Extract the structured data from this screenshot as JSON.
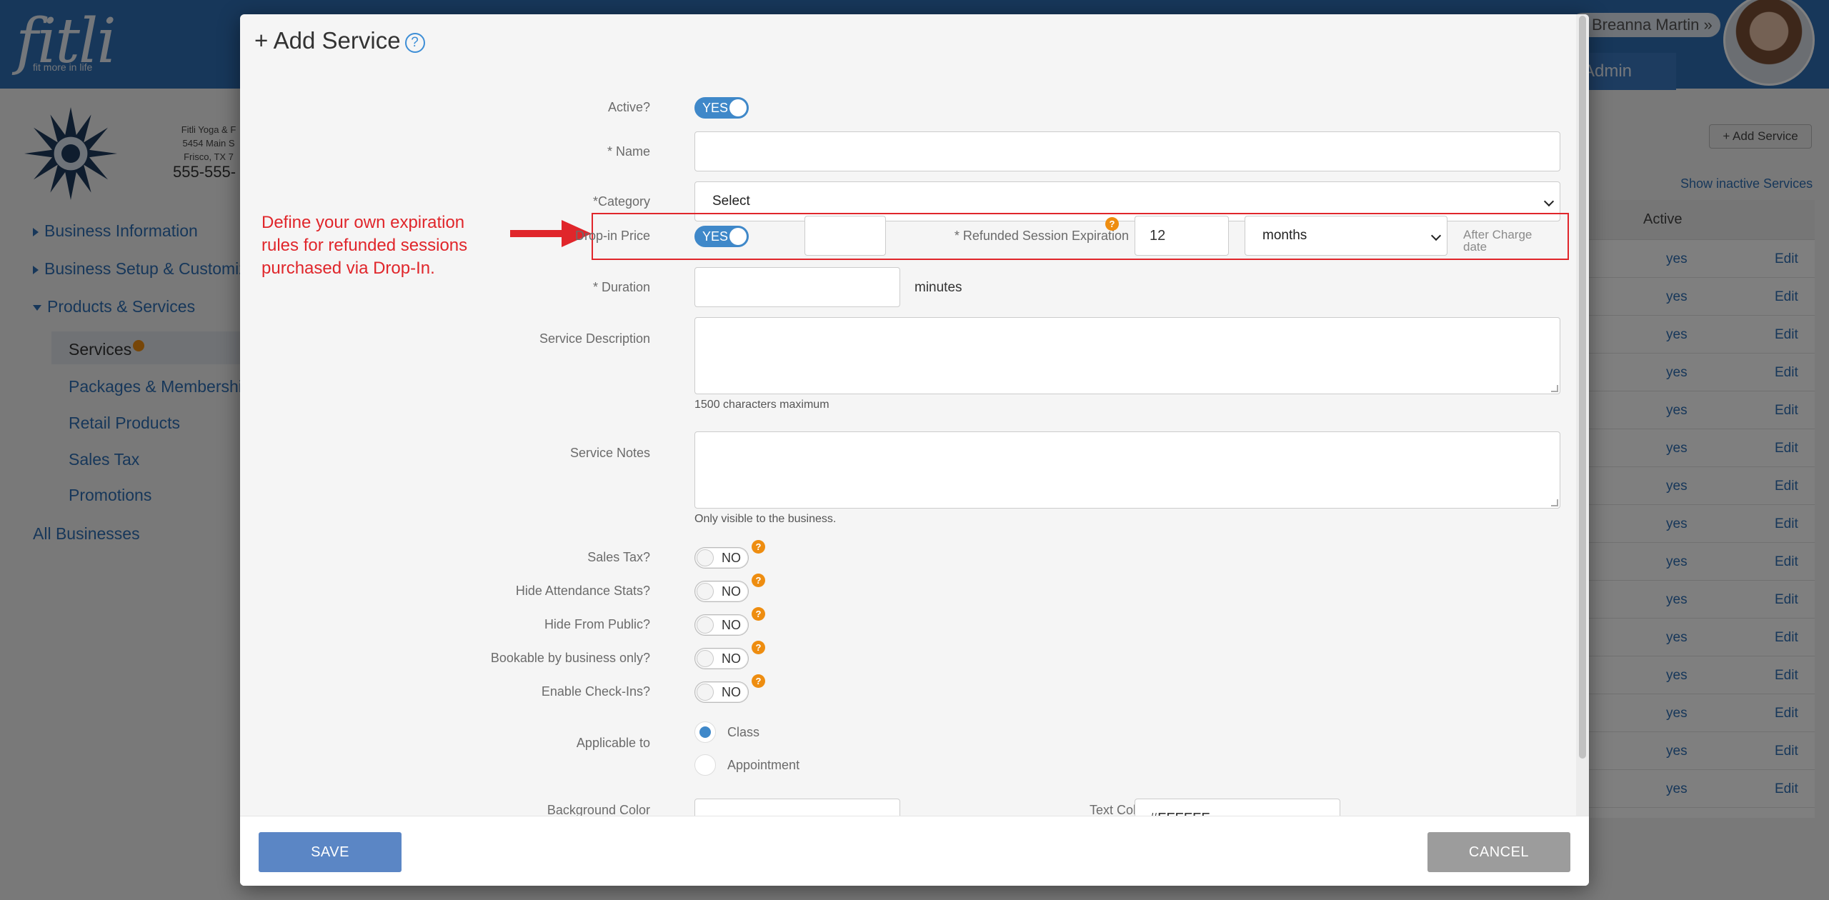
{
  "background": {
    "logo": "fitli",
    "tagline": "fit more in life",
    "user_name": "Breanna Martin",
    "admin_label": "Admin",
    "business_info": [
      "Fitli Yoga & F",
      "5454 Main S",
      "Frisco, TX 7"
    ],
    "phone": "555-555-",
    "nav": {
      "business_information": "Business Information",
      "business_setup": "Business Setup & Customizati",
      "products_services": "Products & Services",
      "services": "Services",
      "packages": "Packages & Memberships",
      "retail": "Retail Products",
      "sales_tax": "Sales Tax",
      "promotions": "Promotions",
      "all_businesses": "All Businesses"
    },
    "add_service_button": "+ Add Service",
    "show_inactive": "Show inactive Services",
    "table_header_active": "Active",
    "rows": [
      {
        "active": "yes",
        "edit": "Edit"
      },
      {
        "active": "yes",
        "edit": "Edit"
      },
      {
        "active": "yes",
        "edit": "Edit"
      },
      {
        "active": "yes",
        "edit": "Edit"
      },
      {
        "active": "yes",
        "edit": "Edit"
      },
      {
        "active": "yes",
        "edit": "Edit"
      },
      {
        "active": "yes",
        "edit": "Edit"
      },
      {
        "active": "yes",
        "edit": "Edit"
      },
      {
        "active": "yes",
        "edit": "Edit"
      },
      {
        "active": "yes",
        "edit": "Edit"
      },
      {
        "active": "yes",
        "edit": "Edit"
      },
      {
        "active": "yes",
        "edit": "Edit"
      },
      {
        "active": "yes",
        "edit": "Edit"
      },
      {
        "active": "yes",
        "edit": "Edit"
      },
      {
        "active": "yes",
        "edit": "Edit"
      }
    ]
  },
  "modal": {
    "title": "+ Add Service",
    "help_icon_glyph": "?",
    "annotation": "Define your own expiration rules for refunded sessions purchased via Drop-In.",
    "fields": {
      "active": {
        "label": "Active?",
        "toggle": "YES"
      },
      "name": {
        "label": "* Name",
        "value": ""
      },
      "category": {
        "label": "*Category",
        "selected": "Select"
      },
      "dropin": {
        "label": "Drop-in Price",
        "toggle": "YES",
        "price": ""
      },
      "refund_expiration": {
        "label": "* Refunded Session Expiration",
        "value": "12",
        "unit": "months",
        "suffix": "After Charge date"
      },
      "duration": {
        "label": "* Duration",
        "value": "",
        "unit": "minutes"
      },
      "description": {
        "label": "Service Description",
        "hint": "1500 characters maximum"
      },
      "notes": {
        "label": "Service Notes",
        "hint": "Only visible to the business."
      },
      "sales_tax": {
        "label": "Sales Tax?",
        "toggle": "NO"
      },
      "hide_attendance": {
        "label": "Hide Attendance Stats?",
        "toggle": "NO"
      },
      "hide_public": {
        "label": "Hide From Public?",
        "toggle": "NO"
      },
      "bookable_business": {
        "label": "Bookable by business only?",
        "toggle": "NO"
      },
      "checkins": {
        "label": "Enable Check-Ins?",
        "toggle": "NO"
      },
      "applicable": {
        "label": "Applicable to",
        "options": [
          "Class",
          "Appointment"
        ],
        "selected": "Class"
      },
      "background_color": {
        "label": "Background Color",
        "value": ""
      },
      "text_color": {
        "label": "Text Color",
        "value": "#FFFFFF"
      }
    },
    "save_label": "SAVE",
    "cancel_label": "CANCEL"
  },
  "colors": {
    "brand_blue": "#2e6fb4",
    "toggle_on": "#3f88c9",
    "annotation_red": "#e0262b",
    "help_orange": "#ee8d10",
    "save_button": "#5b86c5",
    "cancel_button": "#9c9c9c"
  }
}
